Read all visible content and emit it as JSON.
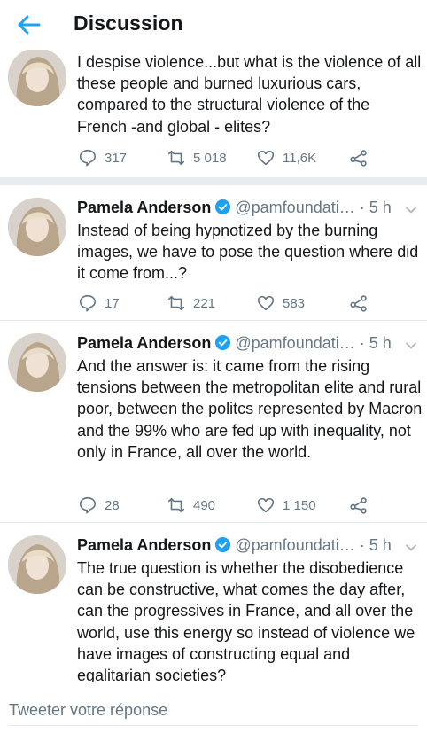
{
  "header": {
    "title": "Discussion"
  },
  "colors": {
    "accent": "#1da1f2",
    "text": "#14171a",
    "muted": "#657786"
  },
  "tweets": [
    {
      "text": "I despise violence...but what is the violence of all these people and burned luxurious cars, compared to the structural violence of the French -and global - elites?",
      "replies": "317",
      "retweets": "5 018",
      "likes": "11,6K"
    },
    {
      "author": "Pamela Anderson",
      "handle": "@pamfoundati…",
      "time": "· 5 h",
      "text": "Instead of being hypnotized by the burning images, we have to pose the question where did it come from...?",
      "replies": "17",
      "retweets": "221",
      "likes": "583"
    },
    {
      "author": "Pamela Anderson",
      "handle": "@pamfoundati…",
      "time": "· 5 h",
      "text": "And the answer is: it came from the rising tensions between the metropolitan elite and rural poor, between the politcs represented by Macron and the 99% who are fed up with inequality, not only in France, all over the world.",
      "replies": "28",
      "retweets": "490",
      "likes": "1 150"
    },
    {
      "author": "Pamela Anderson",
      "handle": "@pamfoundati…",
      "time": "· 5 h",
      "text": "The true question is whether the disobedience can be constructive, what comes the day after, can the progressives in France, and all over the world, use this energy so instead of violence we have images of constructing equal and egalitarian societies?"
    }
  ],
  "reply": {
    "placeholder": "Tweeter votre réponse"
  }
}
